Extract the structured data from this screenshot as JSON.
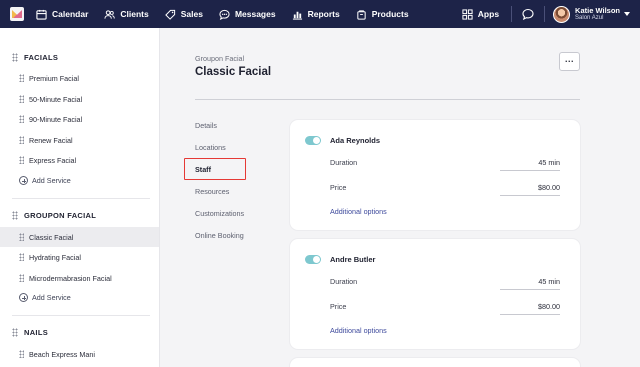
{
  "nav": {
    "items": [
      {
        "label": "Calendar",
        "icon": "calendar-icon"
      },
      {
        "label": "Clients",
        "icon": "clients-icon"
      },
      {
        "label": "Sales",
        "icon": "sales-tag-icon"
      },
      {
        "label": "Messages",
        "icon": "messages-icon"
      },
      {
        "label": "Reports",
        "icon": "reports-icon"
      },
      {
        "label": "Products",
        "icon": "products-icon"
      }
    ],
    "apps_label": "Apps",
    "user_name": "Katie Wilson",
    "user_location": "Salon Azul"
  },
  "sidebar": {
    "groups": [
      {
        "title": "FACIALS",
        "items": [
          "Premium Facial",
          "50-Minute Facial",
          "90-Minute Facial",
          "Renew Facial",
          "Express Facial"
        ],
        "add_label": "Add Service"
      },
      {
        "title": "GROUPON FACIAL",
        "items": [
          "Classic Facial",
          "Hydrating Facial",
          "Microdermabrasion Facial"
        ],
        "add_label": "Add Service"
      },
      {
        "title": "NAILS",
        "items": [
          "Beach Express Mani"
        ]
      }
    ]
  },
  "main": {
    "breadcrumb": "Groupon Facial",
    "title": "Classic Facial",
    "more_label": "...",
    "subnav": [
      "Details",
      "Locations",
      "Staff",
      "Resources",
      "Customizations",
      "Online Booking"
    ],
    "staff": [
      {
        "name": "Ada Reynolds",
        "duration_label": "Duration",
        "duration": "45 min",
        "price_label": "Price",
        "price": "$80.00",
        "options_label": "Additional options"
      },
      {
        "name": "Andre Butler",
        "duration_label": "Duration",
        "duration": "45 min",
        "price_label": "Price",
        "price": "$80.00",
        "options_label": "Additional options"
      }
    ]
  },
  "colors": {
    "topbar": "#1d2348",
    "toggle_on": "#7ec8cf",
    "highlight": "#e53935",
    "link": "#3e4a9c"
  }
}
